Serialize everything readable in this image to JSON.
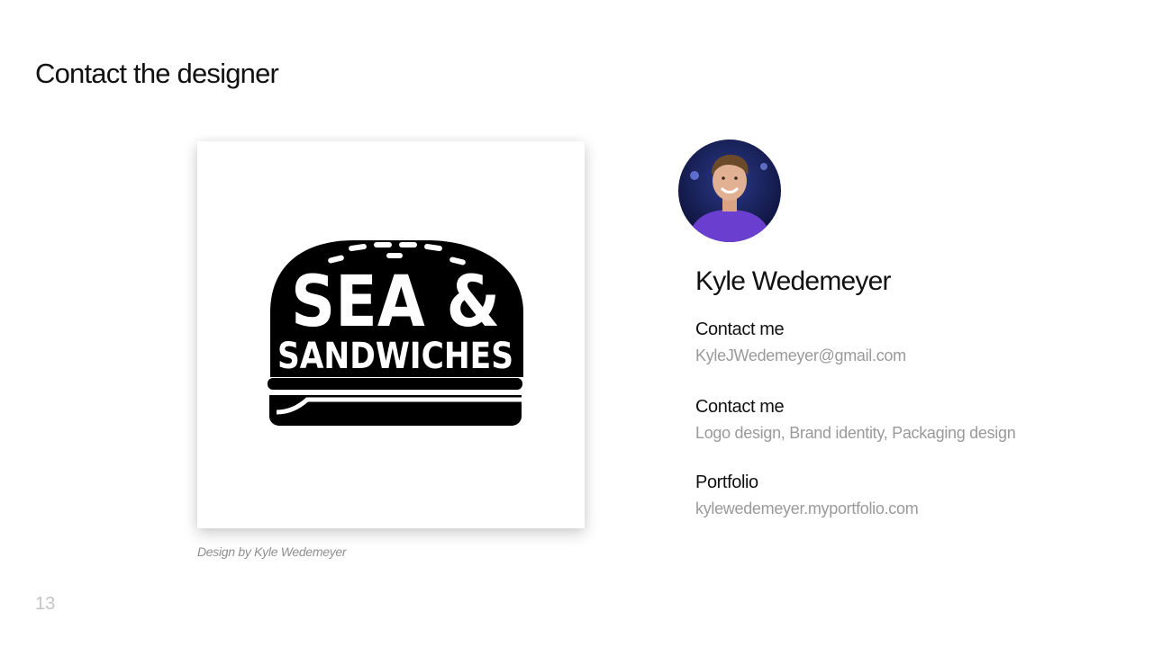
{
  "slide": {
    "title": "Contact the designer",
    "page_number": "13"
  },
  "logo": {
    "line1": "SEA &",
    "line2": "SANDWICHES",
    "icon": "burger-logo-icon"
  },
  "caption": "Design by Kyle Wedemeyer",
  "designer": {
    "name": "Kyle Wedemeyer",
    "avatar_icon": "designer-avatar-photo",
    "contact_label": "Contact me",
    "email": "KyleJWedemeyer@gmail.com",
    "services_label": "Contact me",
    "services": "Logo design, Brand identity, Packaging design",
    "portfolio_label": "Portfolio",
    "portfolio_url": "kylewedemeyer.myportfolio.com"
  },
  "colors": {
    "text": "#111111",
    "muted": "#9a9a9a",
    "logo": "#000000",
    "avatar_shirt": "#6a3fd0",
    "avatar_bg": "#1a1f5a"
  }
}
